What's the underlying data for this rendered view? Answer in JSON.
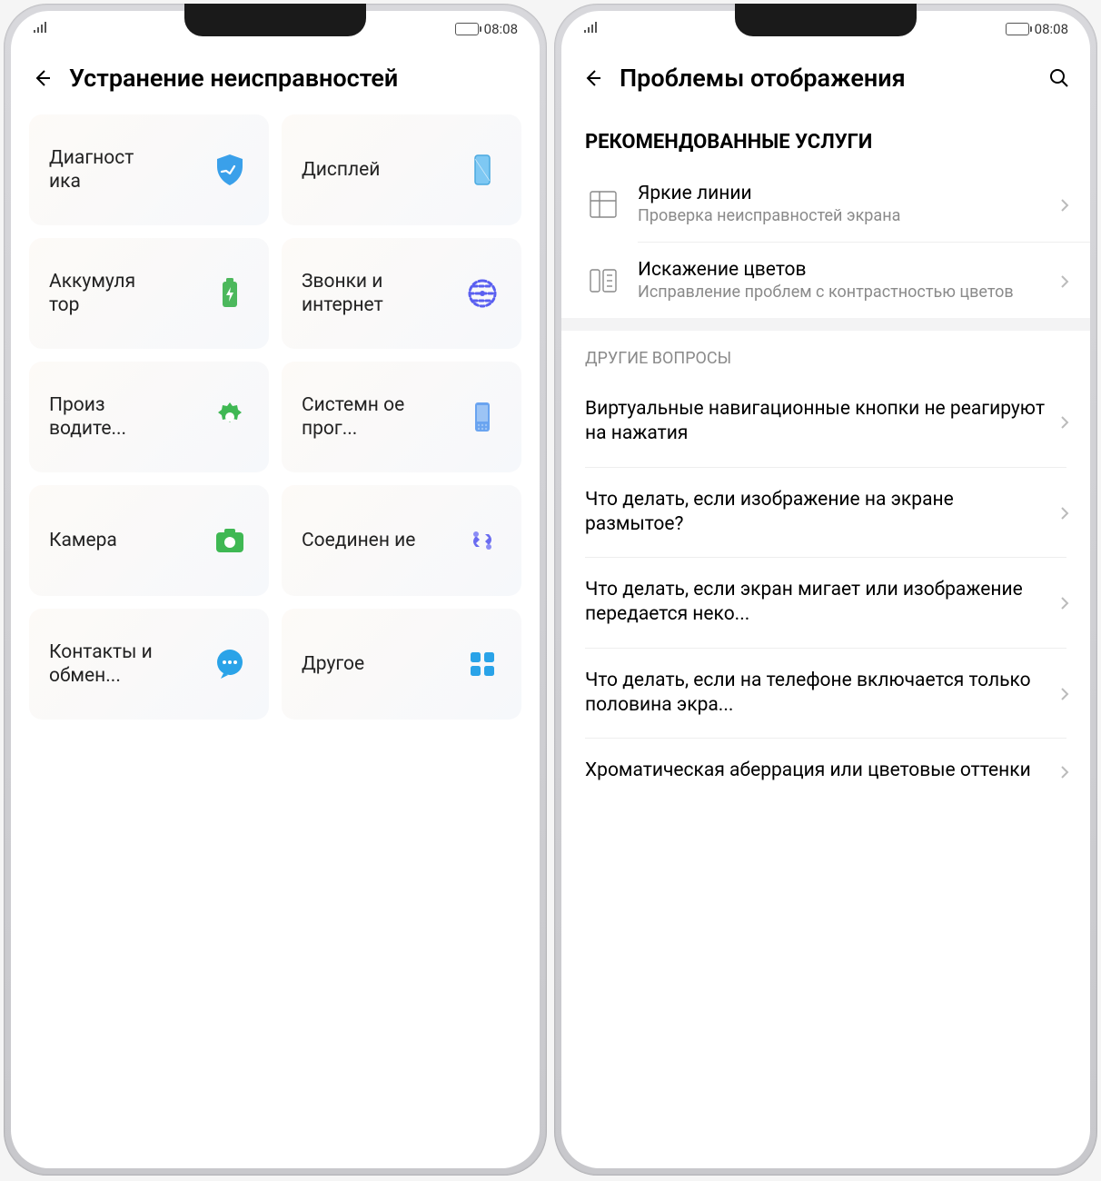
{
  "status": {
    "time": "08:08"
  },
  "left": {
    "title": "Устранение неисправностей",
    "tiles": [
      {
        "label": "Диагност\nика",
        "icon": "shield"
      },
      {
        "label": "Дисплей",
        "icon": "display"
      },
      {
        "label": "Аккумуля\nтор",
        "icon": "battery"
      },
      {
        "label": "Звонки и интернет",
        "icon": "globe"
      },
      {
        "label": "Произ\nводите...",
        "icon": "gear"
      },
      {
        "label": "Системн\nое прог...",
        "icon": "phone"
      },
      {
        "label": "Камера",
        "icon": "camera"
      },
      {
        "label": "Соединен\nие",
        "icon": "link"
      },
      {
        "label": "Контакты и обмен...",
        "icon": "chat"
      },
      {
        "label": "Другое",
        "icon": "grid"
      }
    ]
  },
  "right": {
    "title": "Проблемы отображения",
    "recommended_heading": "РЕКОМЕНДОВАННЫЕ УСЛУГИ",
    "services": [
      {
        "title": "Яркие линии",
        "sub": "Проверка неисправностей экрана",
        "icon": "lines"
      },
      {
        "title": "Искажение цветов",
        "sub": "Исправление проблем с контрастностью цветов",
        "icon": "contrast"
      }
    ],
    "other_heading": "ДРУГИЕ ВОПРОСЫ",
    "questions": [
      "Виртуальные навигационные кнопки не реагируют на нажатия",
      "Что делать, если изображение на экране размытое?",
      "Что делать, если экран мигает или изображение передается неко...",
      "Что делать, если на телефоне включается только половина экра...",
      "Хроматическая аберрация или цветовые оттенки"
    ]
  }
}
